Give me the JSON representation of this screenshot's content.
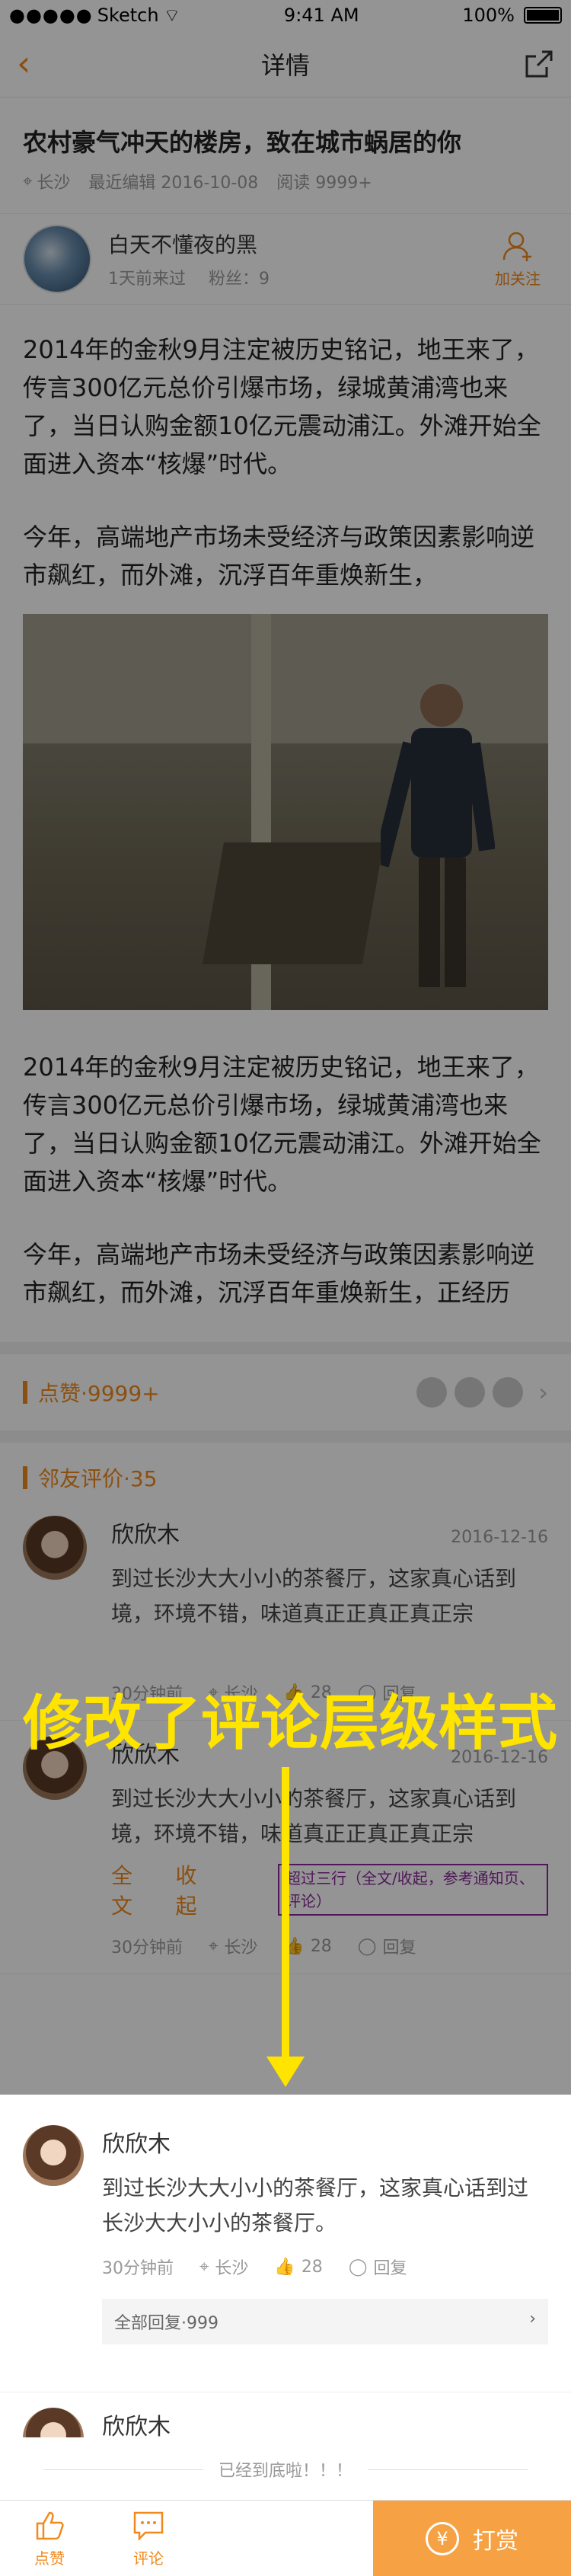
{
  "status": {
    "carrier": "Sketch",
    "time": "9:41 AM",
    "battery": "100%"
  },
  "nav": {
    "title": "详情"
  },
  "article": {
    "title": "农村豪气冲天的楼房，致在城市蜗居的你",
    "location": "长沙",
    "edited": "最近编辑 2016-10-08",
    "reads": "阅读 9999+",
    "paragraph1": "2014年的金秋9月注定被历史铭记，地王来了，传言300亿元总价引爆市场，绿城黄浦湾也来了，当日认购金额10亿元震动浦江。外滩开始全面进入资本“核爆”时代。",
    "paragraph2": "今年，高端地产市场未受经济与政策因素影响逆市飙红，而外滩，沉浮百年重焕新生，",
    "paragraph3": "2014年的金秋9月注定被历史铭记，地王来了，传言300亿元总价引爆市场，绿城黄浦湾也来了，当日认购金额10亿元震动浦江。外滩开始全面进入资本“核爆”时代。",
    "paragraph4": "今年，高端地产市场未受经济与政策因素影响逆市飙红，而外滩，沉浮百年重焕新生，正经历着“史诗级”巨变，全球资本争相讲"
  },
  "author": {
    "name": "白天不懂夜的黑",
    "time": "1天前来过",
    "fans": "粉丝：9",
    "follow": "加关注"
  },
  "likes": {
    "label": "点赞·9999+"
  },
  "comments": {
    "label": "邻友评价·35",
    "items": [
      {
        "name": "欣欣木",
        "date": "2016-12-16",
        "text": "到过长沙大大小小的茶餐厅，这家真心话到境，环境不错，味道真正正真正真正宗",
        "time": "30分钟前",
        "location": "长沙",
        "likes": "28",
        "reply": "回复"
      },
      {
        "name": "欣欣木",
        "date": "2016-12-16",
        "text": "到过长沙大大小小的茶餐厅，这家真心话到境，环境不错，味道真正正真正真正宗",
        "full": "全文",
        "collapse": "收起",
        "time": "30分钟前",
        "location": "长沙",
        "likes": "28",
        "reply": "回复"
      }
    ]
  },
  "annotations": {
    "big": "修改了评论层级样式",
    "note": "超过三行（全文/收起，参考通知页、评论）"
  },
  "new_comments": [
    {
      "name": "欣欣木",
      "text": "到过长沙大大小小的茶餐厅，这家真心话到过长沙大大小小的茶餐厅。",
      "time": "30分钟前",
      "location": "长沙",
      "likes": "28",
      "reply": "回复",
      "all_replies": "全部回复·999"
    },
    {
      "name": "欣欣木"
    }
  ],
  "end_msg": "已经到底啦！！！",
  "tabbar": {
    "like": "点赞",
    "comment": "评论",
    "tip": "打赏"
  },
  "colors": {
    "accent": "#f08a1e",
    "annotation": "#ffe400",
    "note": "#8a2a9a"
  }
}
